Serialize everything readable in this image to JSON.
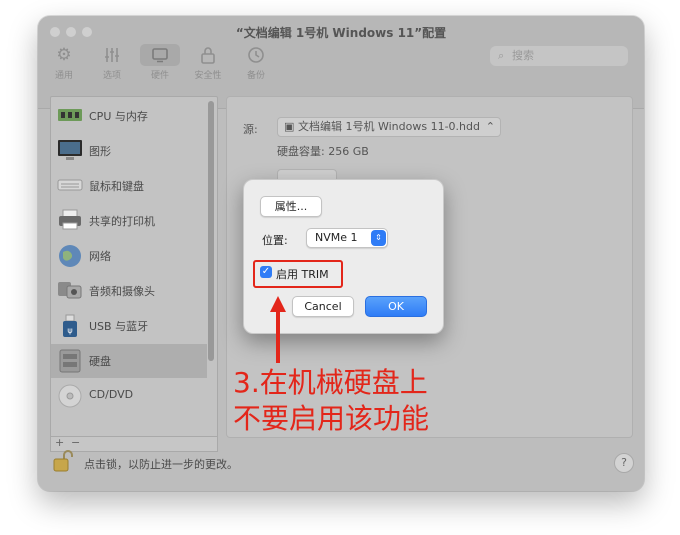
{
  "window": {
    "title": "“文档编辑 1号机 Windows 11”配置",
    "toolbar": [
      {
        "label": "通用",
        "icon": "gear-icon",
        "active": false
      },
      {
        "label": "选项",
        "icon": "sliders-icon",
        "active": false
      },
      {
        "label": "硬件",
        "icon": "hardware-icon",
        "active": true
      },
      {
        "label": "安全性",
        "icon": "lock-icon",
        "active": false
      },
      {
        "label": "备份",
        "icon": "clock-icon",
        "active": false
      }
    ],
    "search_placeholder": "搜索"
  },
  "sidebar": {
    "items": [
      {
        "label": "CPU 与内存",
        "icon": "cpu-memory-icon",
        "selected": false
      },
      {
        "label": "图形",
        "icon": "monitor-icon",
        "selected": false
      },
      {
        "label": "鼠标和键盘",
        "icon": "keyboard-icon",
        "selected": false
      },
      {
        "label": "共享的打印机",
        "icon": "printer-icon",
        "selected": false
      },
      {
        "label": "网络",
        "icon": "globe-icon",
        "selected": false
      },
      {
        "label": "音频和摄像头",
        "icon": "camera-icon",
        "selected": false
      },
      {
        "label": "USB 与蓝牙",
        "icon": "usb-icon",
        "selected": false
      },
      {
        "label": "硬盘",
        "icon": "hard-disk-icon",
        "selected": true
      },
      {
        "label": "CD/DVD",
        "icon": "cd-icon",
        "selected": false
      }
    ],
    "add_label": "+",
    "remove_label": "−"
  },
  "panel": {
    "source_label": "源:",
    "source_value": "文档编辑 1号机 Windows 11-0.hdd",
    "capacity": "硬盘容量: 256 GB",
    "advanced_label": "高级..."
  },
  "dialog": {
    "properties_label": "属性...",
    "location_label": "位置:",
    "location_value": "NVMe 1",
    "trim_label": "启用 TRIM",
    "trim_checked": true,
    "cancel_label": "Cancel",
    "ok_label": "OK"
  },
  "footer": {
    "lock_text": "点击锁，以防止进一步的更改。",
    "help_label": "?"
  },
  "annotation": {
    "line1": "3.在机械硬盘上",
    "line2": "不要启用该功能",
    "color": "#e3261a"
  }
}
